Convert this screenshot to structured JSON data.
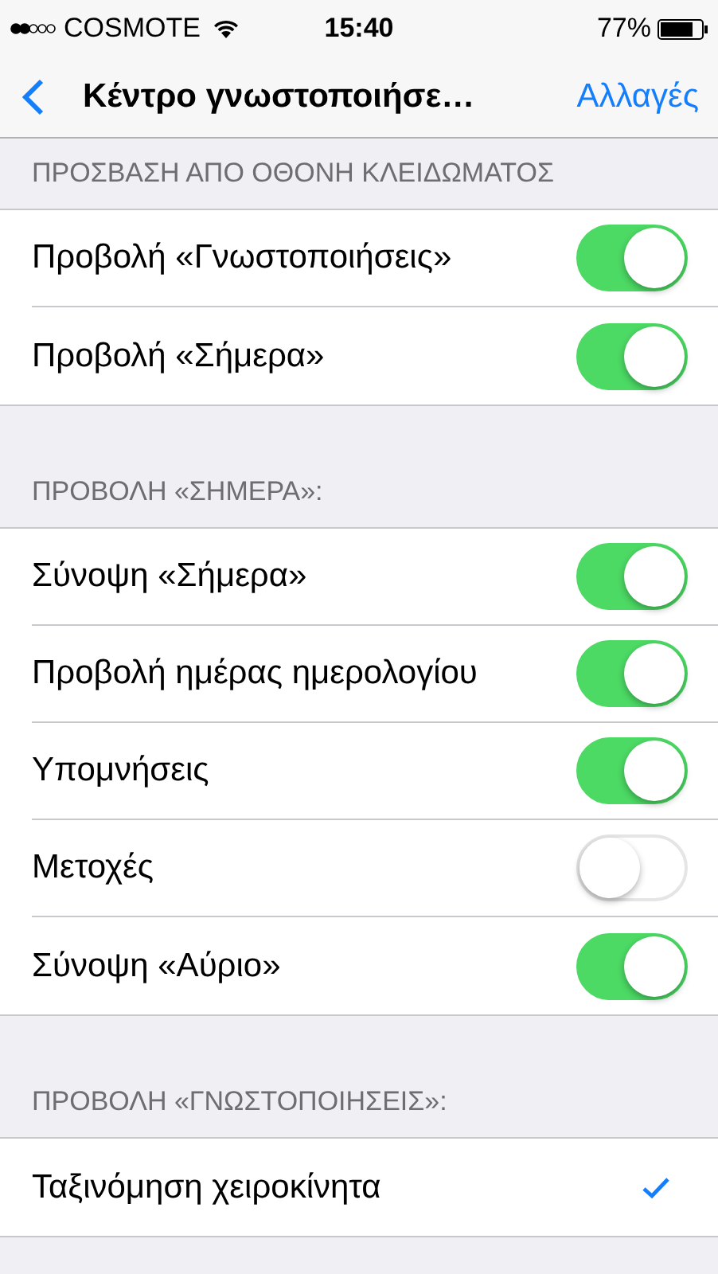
{
  "status_bar": {
    "carrier": "COSMOTE",
    "time": "15:40",
    "battery": "77%"
  },
  "nav_bar": {
    "title": "Κέντρο γνωστοποιήσε…",
    "action": "Αλλαγές"
  },
  "sections": [
    {
      "header": "ΠΡΟΣΒΑΣΗ ΑΠΟ ΟΘΟΝΗ ΚΛΕΙΔΩΜΑΤΟΣ",
      "rows": [
        {
          "kind": "switch",
          "label": "Προβολή «Γνωστοποιήσεις»",
          "on": true
        },
        {
          "kind": "switch",
          "label": "Προβολή «Σήμερα»",
          "on": true
        }
      ]
    },
    {
      "header": "ΠΡΟΒΟΛΗ «ΣΗΜΕΡΑ»:",
      "rows": [
        {
          "kind": "switch",
          "label": "Σύνοψη «Σήμερα»",
          "on": true
        },
        {
          "kind": "switch",
          "label": "Προβολή ημέρας ημερολογίου",
          "on": true
        },
        {
          "kind": "switch",
          "label": "Υπομνήσεις",
          "on": true
        },
        {
          "kind": "switch",
          "label": "Μετοχές",
          "on": false
        },
        {
          "kind": "switch",
          "label": "Σύνοψη «Αύριο»",
          "on": true
        }
      ]
    },
    {
      "header": "ΠΡΟΒΟΛΗ «ΓΝΩΣΤΟΠΟΙΗΣΕΙΣ»:",
      "rows": [
        {
          "kind": "check",
          "label": "Ταξινόμηση χειροκίνητα",
          "selected": true
        }
      ]
    }
  ]
}
